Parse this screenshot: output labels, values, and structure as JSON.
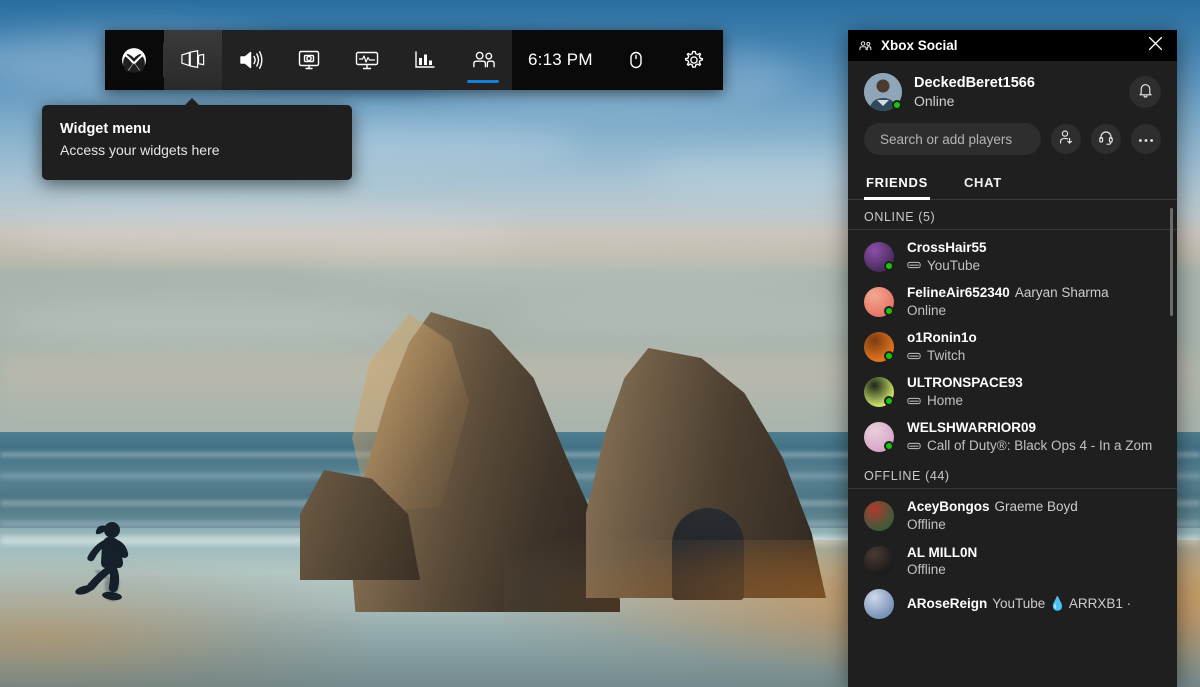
{
  "desktop": {
    "wallpaper_description": "Beach at dusk with rock formations and a running person"
  },
  "widget_bar": {
    "buttons": [
      {
        "name": "xbox-button",
        "icon": "xbox-logo-icon",
        "label": "Xbox",
        "active": false,
        "group": "left"
      },
      {
        "name": "widget-menu-button",
        "icon": "widget-menu-icon",
        "label": "Widget menu",
        "active": true,
        "group": "left"
      },
      {
        "name": "audio-button",
        "icon": "speaker-icon",
        "label": "Audio",
        "active": false,
        "group": "mid"
      },
      {
        "name": "capture-button",
        "icon": "capture-monitor-icon",
        "label": "Capture",
        "active": false,
        "group": "mid"
      },
      {
        "name": "performance-button",
        "icon": "performance-monitor-icon",
        "label": "Performance",
        "active": false,
        "group": "mid"
      },
      {
        "name": "resources-button",
        "icon": "bar-chart-icon",
        "label": "Resources",
        "active": false,
        "group": "mid"
      },
      {
        "name": "xbox-social-button",
        "icon": "people-icon",
        "label": "Xbox Social",
        "active": true,
        "group": "mid"
      }
    ],
    "clock": "6:13 PM",
    "right_buttons": [
      {
        "name": "mouse-button",
        "icon": "mouse-icon",
        "label": "Mouse"
      },
      {
        "name": "settings-button",
        "icon": "gear-icon",
        "label": "Settings"
      }
    ],
    "accent_color": "#1a7fd4"
  },
  "tooltip": {
    "title": "Widget menu",
    "description": "Access your widgets here"
  },
  "social_panel": {
    "title": "Xbox Social",
    "title_icon": "people-icon",
    "close_label": "✕",
    "profile": {
      "gamertag": "DeckedBeret1566",
      "status": "Online",
      "avatar_color": "#6f8ea8",
      "online": true,
      "notifications_icon": "bell-icon"
    },
    "search": {
      "placeholder": "Search or add players",
      "value": ""
    },
    "actions": [
      {
        "name": "add-friend-button",
        "icon": "person-add-icon"
      },
      {
        "name": "party-chat-button",
        "icon": "headset-icon"
      },
      {
        "name": "more-options-button",
        "icon": "ellipsis-icon"
      }
    ],
    "tabs": [
      {
        "label": "FRIENDS",
        "active": true
      },
      {
        "label": "CHAT",
        "active": false
      }
    ],
    "groups": [
      {
        "heading": "ONLINE",
        "count": "(5)",
        "friends": [
          {
            "gamertag": "CrossHair55",
            "realname": "",
            "status": "YouTube",
            "platform_icon": "console-icon",
            "online": true,
            "avatar_color": "#4a2c5e",
            "avatar_color2": "#8e4fa8"
          },
          {
            "gamertag": "FelineAir652340",
            "realname": "Aaryan Sharma",
            "status": "Online",
            "platform_icon": "",
            "online": true,
            "avatar_color": "#e8766a",
            "avatar_color2": "#f2a98f"
          },
          {
            "gamertag": "o1Ronin1o",
            "realname": "",
            "status": "Twitch",
            "platform_icon": "console-icon",
            "online": true,
            "avatar_color": "#e0741f",
            "avatar_color2": "#7a3b12"
          },
          {
            "gamertag": "ULTRONSPACE93",
            "realname": "",
            "status": "Home",
            "platform_icon": "console-icon",
            "online": true,
            "avatar_color": "#c8e06a",
            "avatar_color2": "#1d2418"
          },
          {
            "gamertag": "WELSHWARRIOR09",
            "realname": "",
            "status": "Call of Duty®: Black Ops 4 - In a Zom",
            "platform_icon": "console-icon",
            "online": true,
            "avatar_color": "#d8a8c8",
            "avatar_color2": "#e8d0dc"
          }
        ]
      },
      {
        "heading": "OFFLINE",
        "count": "(44)",
        "friends": [
          {
            "gamertag": "AceyBongos",
            "realname": "Graeme Boyd",
            "status": "Offline",
            "platform_icon": "",
            "online": false,
            "avatar_color": "#3f5a3a",
            "avatar_color2": "#b03a2e"
          },
          {
            "gamertag": "AL MILL0N",
            "realname": "",
            "status": "Offline",
            "platform_icon": "",
            "online": false,
            "avatar_color": "#1b1b1b",
            "avatar_color2": "#4a3a34"
          },
          {
            "gamertag": "ARoseReign",
            "realname": "YouTube 💧 ARRXB1 ·",
            "status": "",
            "platform_icon": "",
            "online": false,
            "avatar_color": "#7a93b8",
            "avatar_color2": "#cfd8e8"
          }
        ]
      }
    ]
  }
}
